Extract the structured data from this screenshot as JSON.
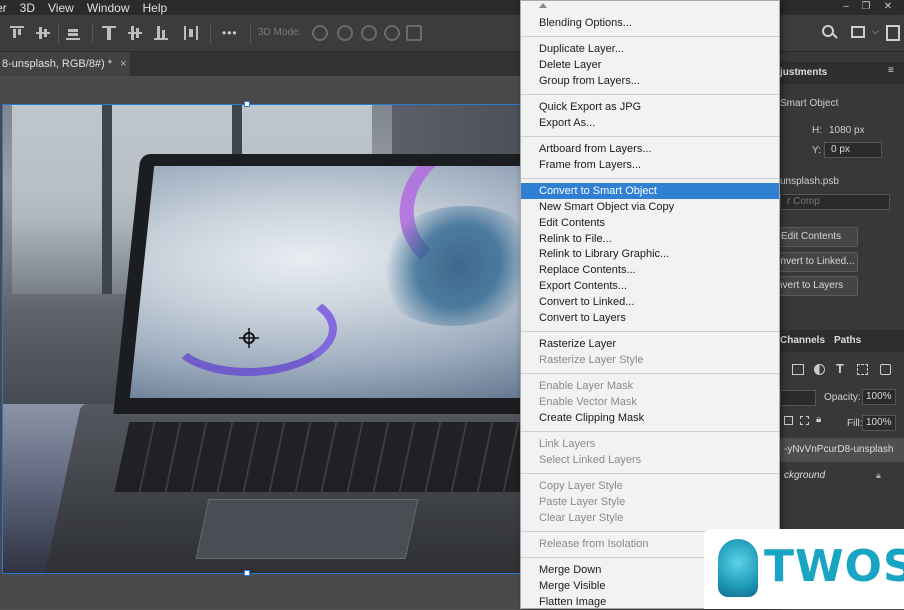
{
  "menubar": {
    "items": [
      "er",
      "3D",
      "View",
      "Window",
      "Help"
    ]
  },
  "optionsbar": {
    "three_d_mode_label": "3D Mode:",
    "more_label": "•••"
  },
  "document": {
    "tab_title": "8-unsplash, RGB/8#) *",
    "close_label": "×"
  },
  "context_menu": {
    "items": [
      {
        "label": "Blending Options...",
        "state": "normal"
      },
      {
        "label": "Duplicate Layer...",
        "state": "normal"
      },
      {
        "label": "Delete Layer",
        "state": "normal"
      },
      {
        "label": "Group from Layers...",
        "state": "normal"
      },
      {
        "label": "Quick Export as JPG",
        "state": "normal"
      },
      {
        "label": "Export As...",
        "state": "normal"
      },
      {
        "label": "Artboard from Layers...",
        "state": "normal"
      },
      {
        "label": "Frame from Layers...",
        "state": "normal"
      },
      {
        "label": "Convert to Smart Object",
        "state": "highlighted"
      },
      {
        "label": "New Smart Object via Copy",
        "state": "normal"
      },
      {
        "label": "Edit Contents",
        "state": "normal"
      },
      {
        "label": "Relink to File...",
        "state": "normal"
      },
      {
        "label": "Relink to Library Graphic...",
        "state": "normal"
      },
      {
        "label": "Replace Contents...",
        "state": "normal"
      },
      {
        "label": "Export Contents...",
        "state": "normal"
      },
      {
        "label": "Convert to Linked...",
        "state": "normal"
      },
      {
        "label": "Convert to Layers",
        "state": "normal"
      },
      {
        "label": "Rasterize Layer",
        "state": "normal"
      },
      {
        "label": "Rasterize Layer Style",
        "state": "disabled"
      },
      {
        "label": "Enable Layer Mask",
        "state": "disabled"
      },
      {
        "label": "Enable Vector Mask",
        "state": "disabled"
      },
      {
        "label": "Create Clipping Mask",
        "state": "normal"
      },
      {
        "label": "Link Layers",
        "state": "disabled"
      },
      {
        "label": "Select Linked Layers",
        "state": "disabled"
      },
      {
        "label": "Copy Layer Style",
        "state": "disabled"
      },
      {
        "label": "Paste Layer Style",
        "state": "disabled"
      },
      {
        "label": "Clear Layer Style",
        "state": "disabled"
      },
      {
        "label": "Release from Isolation",
        "state": "disabled"
      },
      {
        "label": "Merge Down",
        "state": "normal"
      },
      {
        "label": "Merge Visible",
        "state": "normal"
      },
      {
        "label": "Flatten Image",
        "state": "normal"
      }
    ]
  },
  "properties": {
    "tab_label": "justments",
    "type_label": "Smart Object",
    "h_label": "H:",
    "h_value": "1080 px",
    "y_label": "Y:",
    "y_value": "0 px",
    "file_name": "unsplash.psb",
    "comp_placeholder": "r Comp",
    "edit_contents_button": "Edit Contents",
    "convert_linked_button": "onvert to Linked...",
    "convert_layers_button": "nvert to Layers"
  },
  "layers": {
    "channels_tab": "Channels",
    "paths_tab": "Paths",
    "opacity_label": "Opacity:",
    "opacity_value": "100%",
    "fill_label": "Fill:",
    "fill_value": "100%",
    "layer_1": "-yNvVnPcurD8-unsplash",
    "layer_2": "ckground"
  },
  "logo": {
    "text": "TWOS"
  }
}
